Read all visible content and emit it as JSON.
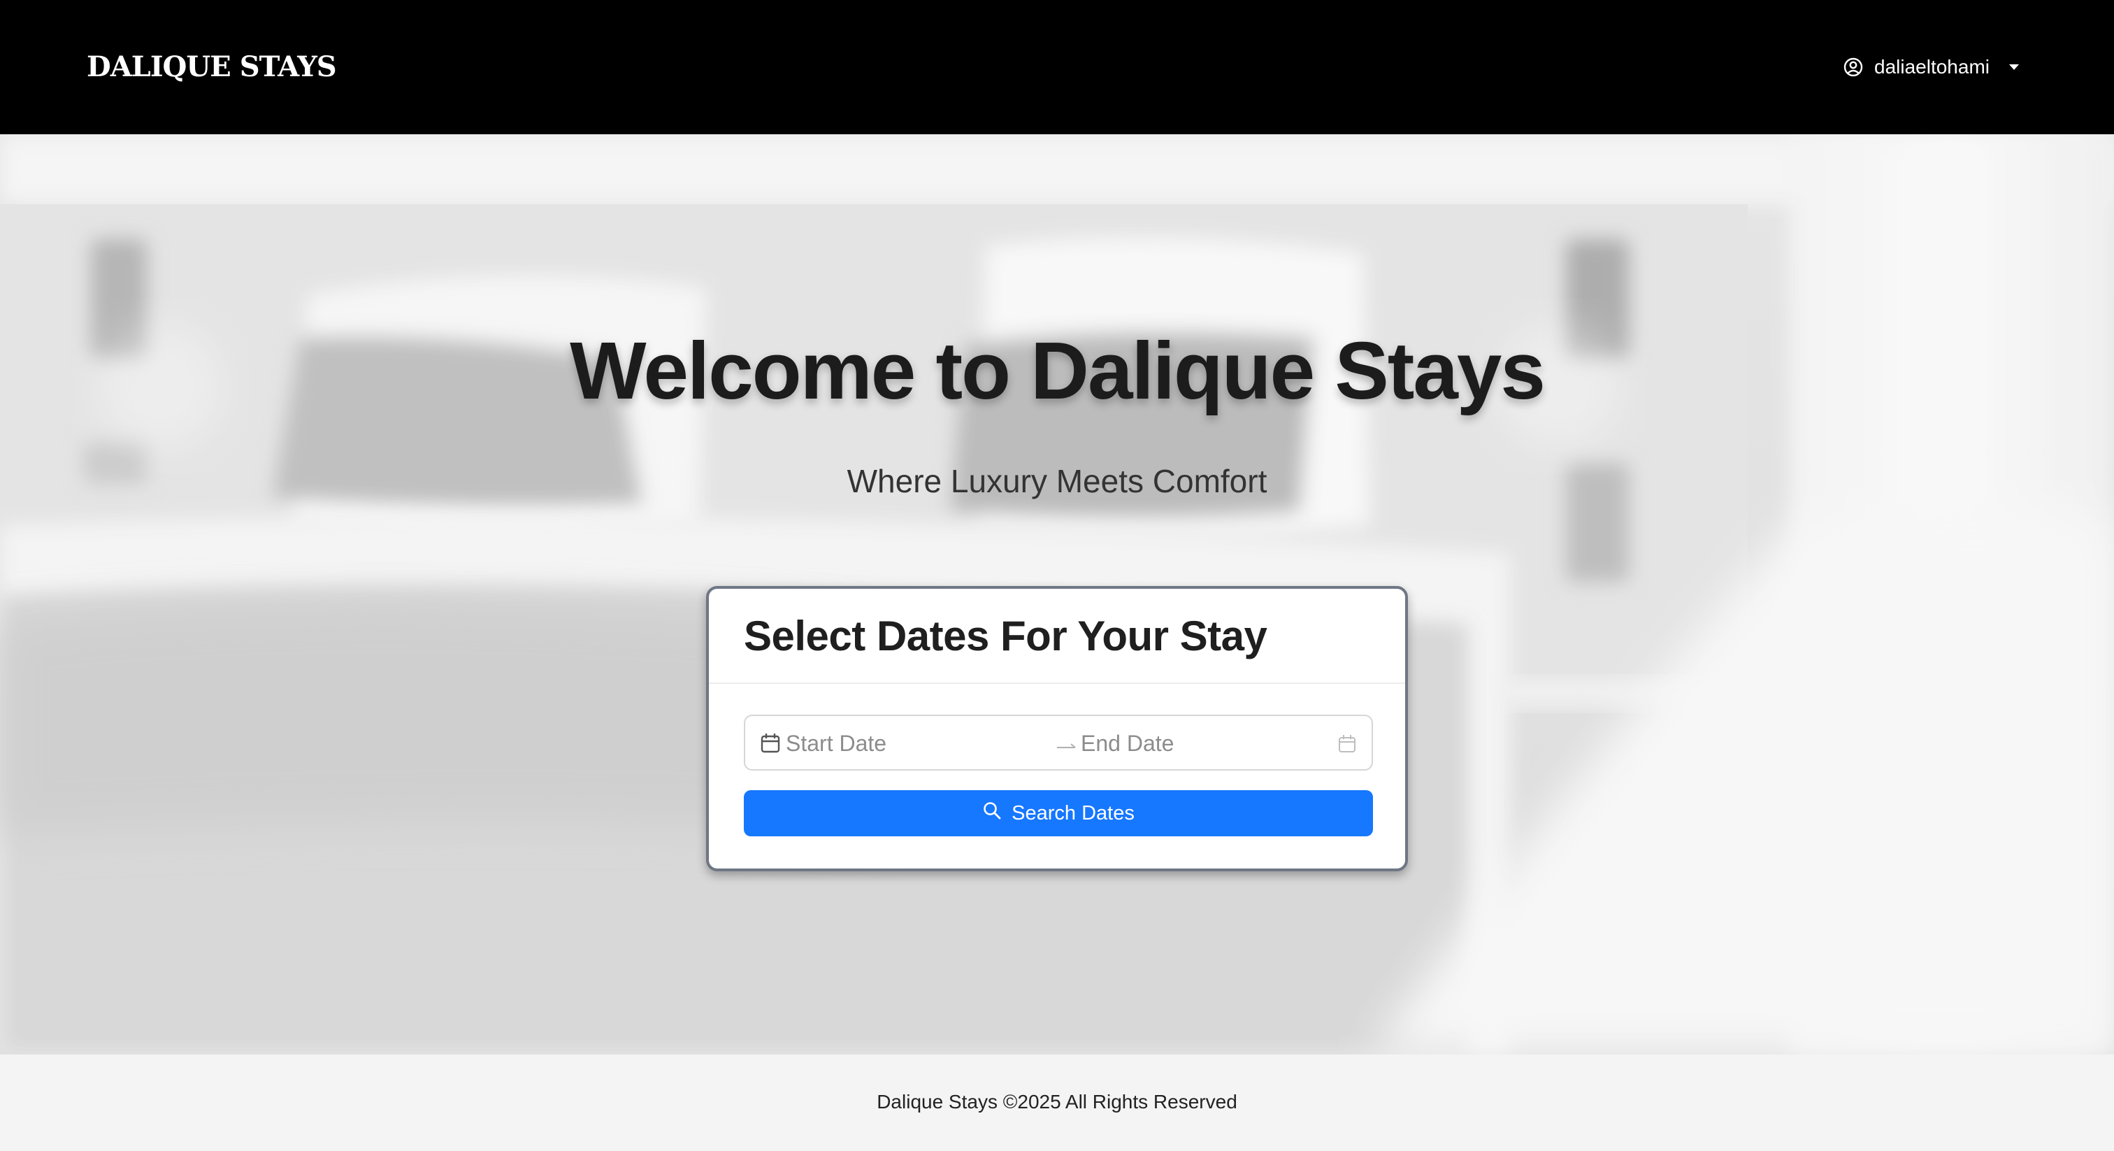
{
  "header": {
    "brand": "DALIQUE STAYS",
    "user": {
      "name": "daliaeltohami",
      "icon": "user-circle-icon",
      "dropdown_icon": "caret-down-icon"
    }
  },
  "hero": {
    "title": "Welcome to Dalique Stays",
    "subtitle": "Where Luxury Meets Comfort"
  },
  "booking": {
    "title": "Select Dates For Your Stay",
    "start_placeholder": "Start Date",
    "end_placeholder": "End Date",
    "search_label": "Search Dates",
    "search_icon": "search-icon",
    "accent_color": "#1677ff"
  },
  "footer": {
    "text": "Dalique Stays ©2025 All Rights Reserved"
  }
}
